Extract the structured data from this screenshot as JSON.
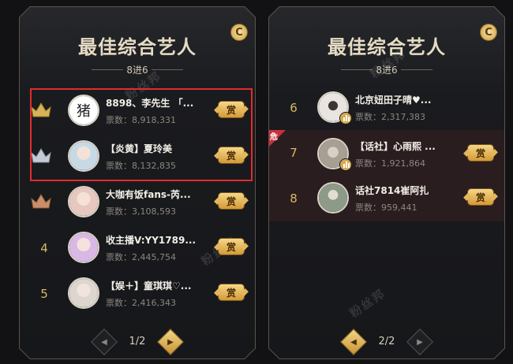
{
  "left_panel": {
    "title": "最佳综合艺人",
    "subtitle": "8进6",
    "badge": "C",
    "watermark": "粉丝邦",
    "vote_label": "票数：",
    "reward_label": "赏",
    "rows": [
      {
        "rank": "",
        "crown": "gold",
        "name": "8898、李先生 「...",
        "votes": "8,918,331",
        "avatar_text": "猪",
        "avatar_color": "#ffffff"
      },
      {
        "rank": "",
        "crown": "silver",
        "name": "【炎黄】夏玲美",
        "votes": "8,132,835",
        "avatar_text": "",
        "avatar_color": "#c8d9e6"
      },
      {
        "rank": "",
        "crown": "bronze",
        "name": "大咖有饭fans-芮...",
        "votes": "3,108,593",
        "avatar_text": "",
        "avatar_color": "#e7c8c0"
      },
      {
        "rank": "4",
        "crown": "",
        "name": "收主播V:YY1789...",
        "votes": "2,445,754",
        "avatar_text": "",
        "avatar_color": "#d9b8e6"
      },
      {
        "rank": "5",
        "crown": "",
        "name": "【娱＋】童琪琪♡...",
        "votes": "2,416,343",
        "avatar_text": "",
        "avatar_color": "#ddd6cf"
      }
    ],
    "pager": "1/2"
  },
  "right_panel": {
    "title": "最佳综合艺人",
    "subtitle": "8进6",
    "badge": "C",
    "watermark": "粉丝邦",
    "vote_label": "票数：",
    "reward_label": "赏",
    "danger_label": "危",
    "rows": [
      {
        "rank": "6",
        "name": "北京妞田子晴♥...",
        "votes": "2,317,383",
        "avatar_color": "#e8e4df",
        "live": true,
        "danger": false,
        "reward": false
      },
      {
        "rank": "7",
        "name": "【话社】心雨熙 ...",
        "votes": "1,921,864",
        "avatar_color": "#a89f94",
        "live": true,
        "danger": true,
        "reward": true
      },
      {
        "rank": "8",
        "name": "话社7814崔阿扎",
        "votes": "959,441",
        "avatar_color": "#8d9a88",
        "live": false,
        "danger": false,
        "reward": true
      }
    ],
    "pager": "2/2"
  },
  "colors": {
    "gold": "#d8b259",
    "silver": "#c5cbd6",
    "bronze": "#c98f6a",
    "highlight": "#e02d2d"
  }
}
